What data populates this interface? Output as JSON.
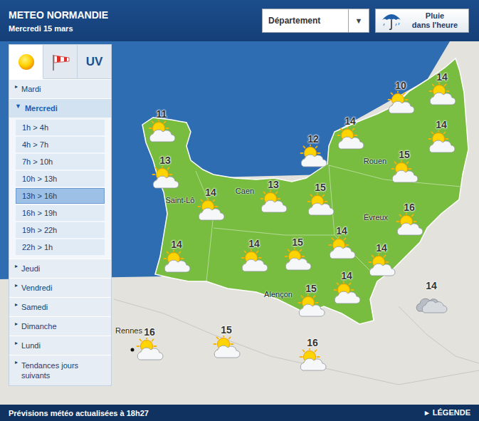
{
  "header": {
    "title": "METEO NORMANDIE",
    "date": "Mercredi 15 mars",
    "select": {
      "value": "Département",
      "arrow": "▼"
    },
    "rain_button": {
      "lines": [
        "Pluie",
        "dans l'heure"
      ]
    }
  },
  "panel": {
    "tabs": [
      {
        "kind": "sun",
        "selected": true
      },
      {
        "kind": "wind",
        "selected": false
      },
      {
        "kind": "text",
        "label": "UV",
        "selected": false
      }
    ],
    "days": [
      {
        "label": "Mardi",
        "marker": "▸",
        "expanded": false
      },
      {
        "label": "Mercredi",
        "marker": "▼",
        "expanded": true,
        "slots": [
          {
            "label": "1h > 4h",
            "selected": false
          },
          {
            "label": "4h > 7h",
            "selected": false
          },
          {
            "label": "7h > 10h",
            "selected": false
          },
          {
            "label": "10h > 13h",
            "selected": false
          },
          {
            "label": "13h > 16h",
            "selected": true
          },
          {
            "label": "16h > 19h",
            "selected": false
          },
          {
            "label": "19h > 22h",
            "selected": false
          },
          {
            "label": "22h > 1h",
            "selected": false
          }
        ]
      },
      {
        "label": "Jeudi",
        "marker": "▸",
        "expanded": false
      },
      {
        "label": "Vendredi",
        "marker": "▸",
        "expanded": false
      },
      {
        "label": "Samedi",
        "marker": "▸",
        "expanded": false
      },
      {
        "label": "Dimanche",
        "marker": "▸",
        "expanded": false
      },
      {
        "label": "Lundi",
        "marker": "▸",
        "expanded": false
      },
      {
        "label": "Tendances jours suivants",
        "marker": "▸",
        "expanded": false
      }
    ]
  },
  "map": {
    "cities": [
      {
        "name": "Saint-Lô",
        "dot": false
      },
      {
        "name": "Caen",
        "dot": false
      },
      {
        "name": "Rouen",
        "dot": false
      },
      {
        "name": "Évreux",
        "dot": false
      },
      {
        "name": "Alençon",
        "dot": false
      },
      {
        "name": "Rennes",
        "dot": true
      }
    ],
    "forecasts": [
      {
        "temp": "11",
        "kind": "sun-cloud"
      },
      {
        "temp": "13",
        "kind": "sun-cloud"
      },
      {
        "temp": "14",
        "kind": "sun-cloud"
      },
      {
        "temp": "14",
        "kind": "sun-cloud"
      },
      {
        "temp": "14",
        "kind": "sun-cloud"
      },
      {
        "temp": "13",
        "kind": "sun-cloud"
      },
      {
        "temp": "15",
        "kind": "sun-cloud"
      },
      {
        "temp": "15",
        "kind": "sun-cloud"
      },
      {
        "temp": "12",
        "kind": "sun-cloud"
      },
      {
        "temp": "14",
        "kind": "sun-cloud"
      },
      {
        "temp": "10",
        "kind": "sun-cloud"
      },
      {
        "temp": "14",
        "kind": "sun-cloud"
      },
      {
        "temp": "14",
        "kind": "sun-cloud"
      },
      {
        "temp": "15",
        "kind": "sun-cloud"
      },
      {
        "temp": "16",
        "kind": "sun-cloud"
      },
      {
        "temp": "14",
        "kind": "sun-cloud"
      },
      {
        "temp": "14",
        "kind": "sun-cloud"
      },
      {
        "temp": "14",
        "kind": "sun-cloud"
      },
      {
        "temp": "15",
        "kind": "sun-cloud"
      },
      {
        "temp": "14",
        "kind": "cloud"
      },
      {
        "temp": "16",
        "kind": "sun-cloud"
      },
      {
        "temp": "15",
        "kind": "sun-cloud"
      },
      {
        "temp": "16",
        "kind": "sun-cloud"
      }
    ]
  },
  "footer": {
    "text": "Prévisions météo actualisées à 18h27",
    "legend": {
      "marker": "▸",
      "label": "LÉGENDE"
    }
  }
}
